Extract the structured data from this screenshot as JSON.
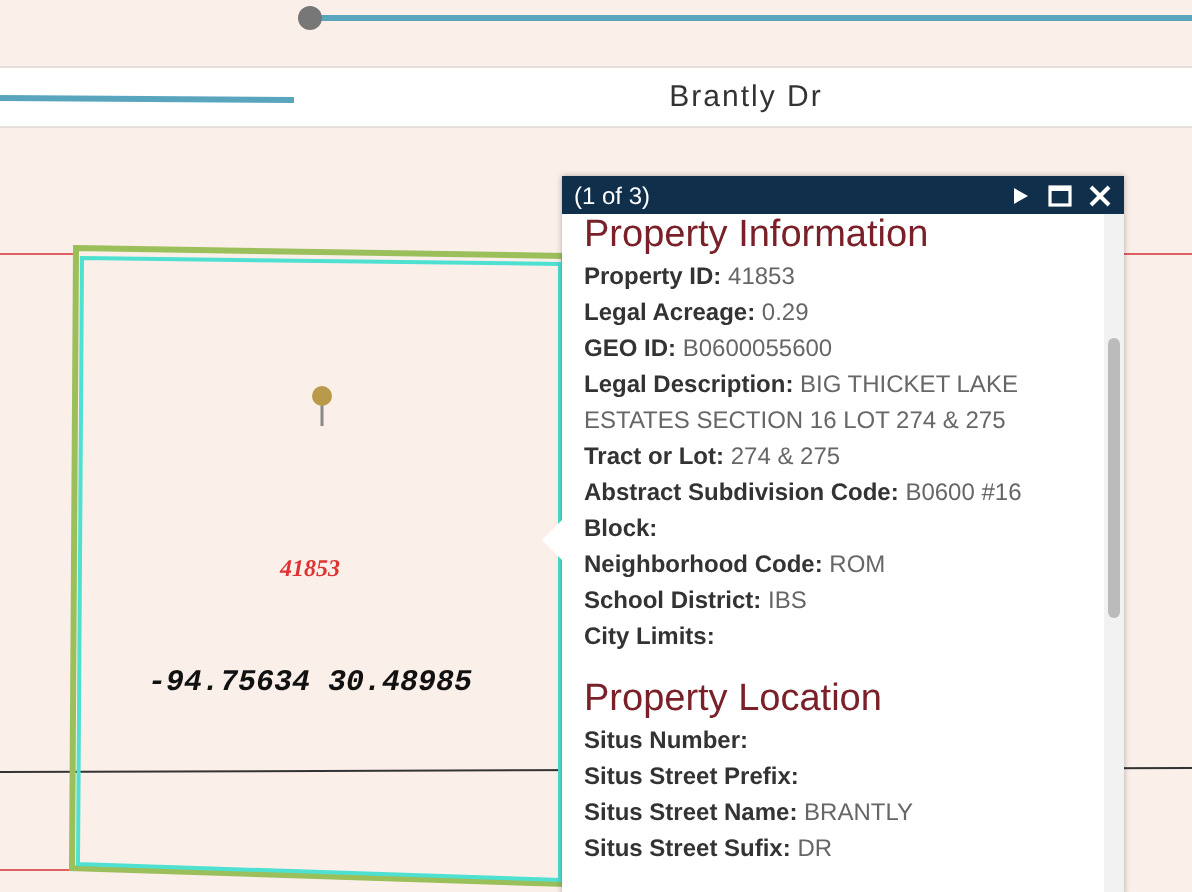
{
  "map": {
    "road_label": "Brantly Dr",
    "parcel_label": "41853",
    "coordinates": "-94.75634 30.48985"
  },
  "popup": {
    "counter": "(1 of 3)",
    "sections": [
      {
        "heading": "Property Information",
        "fields": [
          {
            "label": "Property ID:",
            "value": "41853"
          },
          {
            "label": "Legal Acreage:",
            "value": "0.29"
          },
          {
            "label": "GEO ID:",
            "value": "B0600055600"
          },
          {
            "label": "Legal Description:",
            "value": "BIG THICKET LAKE ESTATES SECTION 16 LOT 274 & 275"
          },
          {
            "label": "Tract or Lot:",
            "value": "274 & 275"
          },
          {
            "label": "Abstract Subdivision Code:",
            "value": "B0600 #16"
          },
          {
            "label": "Block:"
          },
          {
            "label": "Neighborhood Code:",
            "value": "ROM"
          },
          {
            "label": "School District:",
            "value": "IBS"
          },
          {
            "label": "City Limits:"
          }
        ]
      },
      {
        "heading": "Property Location",
        "fields": [
          {
            "label": "Situs Number:"
          },
          {
            "label": "Situs Street Prefix:"
          },
          {
            "label": "Situs Street Name:",
            "value": "BRANTLY"
          },
          {
            "label": "Situs Street Sufix:",
            "value": "DR"
          }
        ]
      }
    ]
  }
}
